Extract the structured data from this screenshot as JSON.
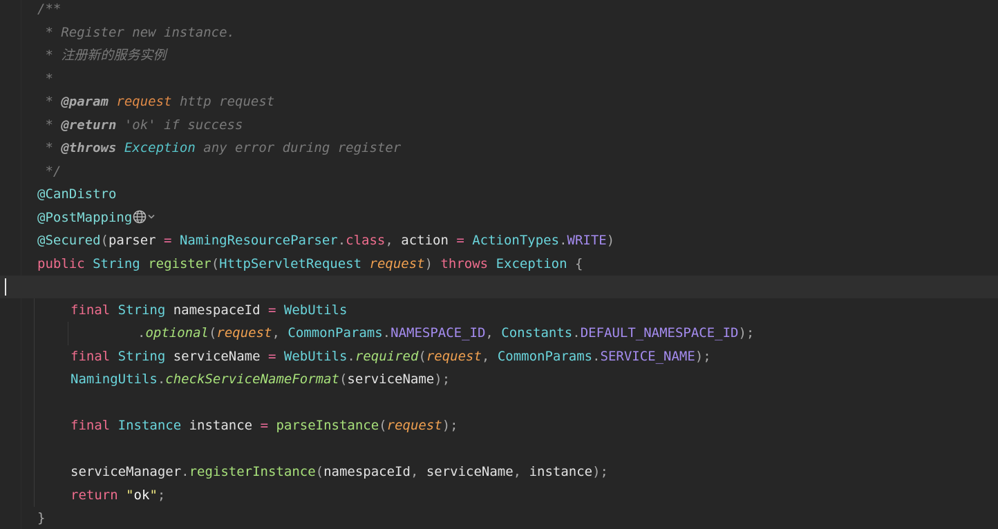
{
  "editor": {
    "language": "java",
    "lines": [
      {
        "indent": 1,
        "tokens": [
          {
            "t": "/**",
            "k": "comment"
          }
        ]
      },
      {
        "indent": 1,
        "tokens": [
          {
            "t": " * Register new instance.",
            "k": "comment"
          }
        ]
      },
      {
        "indent": 1,
        "tokens": [
          {
            "t": " * 注册新的服务实例",
            "k": "comment"
          }
        ]
      },
      {
        "indent": 1,
        "tokens": [
          {
            "t": " *",
            "k": "comment"
          }
        ]
      },
      {
        "indent": 1,
        "tokens": [
          {
            "t": " * ",
            "k": "comment"
          },
          {
            "t": "@param",
            "k": "doctag"
          },
          {
            "t": " ",
            "k": "comment"
          },
          {
            "t": "request",
            "k": "docparam"
          },
          {
            "t": " http request",
            "k": "comment"
          }
        ]
      },
      {
        "indent": 1,
        "tokens": [
          {
            "t": " * ",
            "k": "comment"
          },
          {
            "t": "@return",
            "k": "doctag"
          },
          {
            "t": " 'ok' if success",
            "k": "comment"
          }
        ]
      },
      {
        "indent": 1,
        "tokens": [
          {
            "t": " * ",
            "k": "comment"
          },
          {
            "t": "@throws",
            "k": "doctag"
          },
          {
            "t": " ",
            "k": "comment"
          },
          {
            "t": "Exception",
            "k": "doctype"
          },
          {
            "t": " any error during register",
            "k": "comment"
          }
        ]
      },
      {
        "indent": 1,
        "tokens": [
          {
            "t": " */",
            "k": "comment"
          }
        ]
      },
      {
        "indent": 1,
        "tokens": [
          {
            "t": "@CanDistro",
            "k": "annot"
          }
        ]
      },
      {
        "indent": 1,
        "tokens": [
          {
            "t": "@PostMapping",
            "k": "annot"
          }
        ],
        "globe_icon": true
      },
      {
        "indent": 1,
        "tokens": [
          {
            "t": "@Secured",
            "k": "annot"
          },
          {
            "t": "(",
            "k": "punct"
          },
          {
            "t": "parser",
            "k": "plain"
          },
          {
            "t": " = ",
            "k": "op"
          },
          {
            "t": "NamingResourceParser",
            "k": "type"
          },
          {
            "t": ".",
            "k": "punct"
          },
          {
            "t": "class",
            "k": "keyword"
          },
          {
            "t": ", ",
            "k": "punct"
          },
          {
            "t": "action",
            "k": "plain"
          },
          {
            "t": " = ",
            "k": "op"
          },
          {
            "t": "ActionTypes",
            "k": "type"
          },
          {
            "t": ".",
            "k": "punct"
          },
          {
            "t": "WRITE",
            "k": "const"
          },
          {
            "t": ")",
            "k": "punct"
          }
        ]
      },
      {
        "indent": 1,
        "tokens": [
          {
            "t": "public",
            "k": "keyword"
          },
          {
            "t": " ",
            "k": "plain"
          },
          {
            "t": "String",
            "k": "type"
          },
          {
            "t": " ",
            "k": "plain"
          },
          {
            "t": "register",
            "k": "method"
          },
          {
            "t": "(",
            "k": "punct"
          },
          {
            "t": "HttpServletRequest",
            "k": "type"
          },
          {
            "t": " ",
            "k": "plain"
          },
          {
            "t": "request",
            "k": "param"
          },
          {
            "t": ") ",
            "k": "punct"
          },
          {
            "t": "throws",
            "k": "keyword"
          },
          {
            "t": " ",
            "k": "plain"
          },
          {
            "t": "Exception",
            "k": "type"
          },
          {
            "t": " {",
            "k": "punct"
          }
        ]
      },
      {
        "indent": 0,
        "tokens": [],
        "current": true
      },
      {
        "indent": 2,
        "tokens": [
          {
            "t": "final",
            "k": "keyword"
          },
          {
            "t": " ",
            "k": "plain"
          },
          {
            "t": "String",
            "k": "type"
          },
          {
            "t": " namespaceId",
            "k": "plain"
          },
          {
            "t": " = ",
            "k": "op"
          },
          {
            "t": "WebUtils",
            "k": "type"
          }
        ]
      },
      {
        "indent": 4,
        "tokens": [
          {
            "t": ".",
            "k": "punct"
          },
          {
            "t": "optional",
            "k": "method-i"
          },
          {
            "t": "(",
            "k": "punct"
          },
          {
            "t": "request",
            "k": "param"
          },
          {
            "t": ", ",
            "k": "punct"
          },
          {
            "t": "CommonParams",
            "k": "type"
          },
          {
            "t": ".",
            "k": "punct"
          },
          {
            "t": "NAMESPACE_ID",
            "k": "const"
          },
          {
            "t": ", ",
            "k": "punct"
          },
          {
            "t": "Constants",
            "k": "type"
          },
          {
            "t": ".",
            "k": "punct"
          },
          {
            "t": "DEFAULT_NAMESPACE_ID",
            "k": "const"
          },
          {
            "t": ");",
            "k": "punct"
          }
        ]
      },
      {
        "indent": 2,
        "tokens": [
          {
            "t": "final",
            "k": "keyword"
          },
          {
            "t": " ",
            "k": "plain"
          },
          {
            "t": "String",
            "k": "type"
          },
          {
            "t": " serviceName",
            "k": "plain"
          },
          {
            "t": " = ",
            "k": "op"
          },
          {
            "t": "WebUtils",
            "k": "type"
          },
          {
            "t": ".",
            "k": "punct"
          },
          {
            "t": "required",
            "k": "method-i"
          },
          {
            "t": "(",
            "k": "punct"
          },
          {
            "t": "request",
            "k": "param"
          },
          {
            "t": ", ",
            "k": "punct"
          },
          {
            "t": "CommonParams",
            "k": "type"
          },
          {
            "t": ".",
            "k": "punct"
          },
          {
            "t": "SERVICE_NAME",
            "k": "const"
          },
          {
            "t": ");",
            "k": "punct"
          }
        ]
      },
      {
        "indent": 2,
        "tokens": [
          {
            "t": "NamingUtils",
            "k": "type"
          },
          {
            "t": ".",
            "k": "punct"
          },
          {
            "t": "checkServiceNameFormat",
            "k": "method-i"
          },
          {
            "t": "(",
            "k": "punct"
          },
          {
            "t": "serviceName",
            "k": "plain"
          },
          {
            "t": ");",
            "k": "punct"
          }
        ]
      },
      {
        "indent": 0,
        "tokens": []
      },
      {
        "indent": 2,
        "tokens": [
          {
            "t": "final",
            "k": "keyword"
          },
          {
            "t": " ",
            "k": "plain"
          },
          {
            "t": "Instance",
            "k": "type"
          },
          {
            "t": " instance",
            "k": "plain"
          },
          {
            "t": " = ",
            "k": "op"
          },
          {
            "t": "parseInstance",
            "k": "method"
          },
          {
            "t": "(",
            "k": "punct"
          },
          {
            "t": "request",
            "k": "param"
          },
          {
            "t": ");",
            "k": "punct"
          }
        ]
      },
      {
        "indent": 0,
        "tokens": []
      },
      {
        "indent": 2,
        "tokens": [
          {
            "t": "serviceManager",
            "k": "plain"
          },
          {
            "t": ".",
            "k": "punct"
          },
          {
            "t": "registerInstance",
            "k": "method"
          },
          {
            "t": "(",
            "k": "punct"
          },
          {
            "t": "namespaceId",
            "k": "plain"
          },
          {
            "t": ", ",
            "k": "punct"
          },
          {
            "t": "serviceName",
            "k": "plain"
          },
          {
            "t": ", ",
            "k": "punct"
          },
          {
            "t": "instance",
            "k": "plain"
          },
          {
            "t": ");",
            "k": "punct"
          }
        ]
      },
      {
        "indent": 2,
        "tokens": [
          {
            "t": "return",
            "k": "keyword"
          },
          {
            "t": " ",
            "k": "plain"
          },
          {
            "t": "\"",
            "k": "string-q"
          },
          {
            "t": "ok",
            "k": "string"
          },
          {
            "t": "\"",
            "k": "string-q"
          },
          {
            "t": ";",
            "k": "punct"
          }
        ]
      },
      {
        "indent": 1,
        "tokens": [
          {
            "t": "}",
            "k": "punct"
          }
        ]
      }
    ]
  },
  "icons": {
    "globe": "globe-icon",
    "chevron": "chevron-down-icon"
  },
  "colors": {
    "background": "#262626",
    "current_line": "#2f2f2f",
    "comment": "#7a7a7a",
    "keyword": "#ef6d8e",
    "type": "#6ad5dc",
    "method": "#a7e07a",
    "parameter": "#f0a050",
    "constant": "#a58cf0",
    "string": "#f4ec83"
  }
}
